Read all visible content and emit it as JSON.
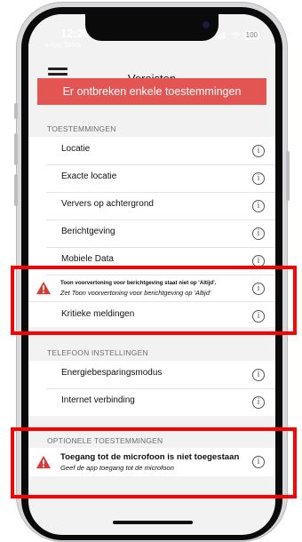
{
  "status_bar": {
    "time": "12:20",
    "back_label": "◂ App Store",
    "battery": "100"
  },
  "nav": {
    "title": "Vereisten"
  },
  "banner": {
    "text": "Er ontbreken enkele toestemmingen"
  },
  "permissions": {
    "header": "TOESTEMMINGEN",
    "items": [
      {
        "label": "Locatie"
      },
      {
        "label": "Exacte locatie"
      },
      {
        "label": "Ververs op achtergrond"
      },
      {
        "label": "Berichtgeving"
      },
      {
        "label": "Mobiele Data"
      }
    ],
    "warning": {
      "title": "Toon voorvertoning voor berichtgeving staat niet op 'Altijd'.",
      "subtitle": "Zet Toon voorvertoning voor berichtgeving op 'Altijd'"
    },
    "critical": {
      "label": "Kritieke meldingen"
    }
  },
  "phone_settings": {
    "header": "TELEFOON INSTELLINGEN",
    "items": [
      {
        "label": "Energiebesparingsmodus"
      },
      {
        "label": "Internet verbinding"
      }
    ]
  },
  "optional": {
    "header": "OPTIONELE TOESTEMMINGEN",
    "warning": {
      "title": "Toegang tot de microfoon is niet toegestaan",
      "subtitle": "Geef de app toegang tot de microfoon"
    }
  },
  "colors": {
    "banner": "#e25552",
    "highlight": "#ff0000",
    "warning": "#d93a36"
  },
  "icons": {
    "info": "info-icon",
    "warning": "warning-icon",
    "menu": "hamburger-menu-icon"
  }
}
